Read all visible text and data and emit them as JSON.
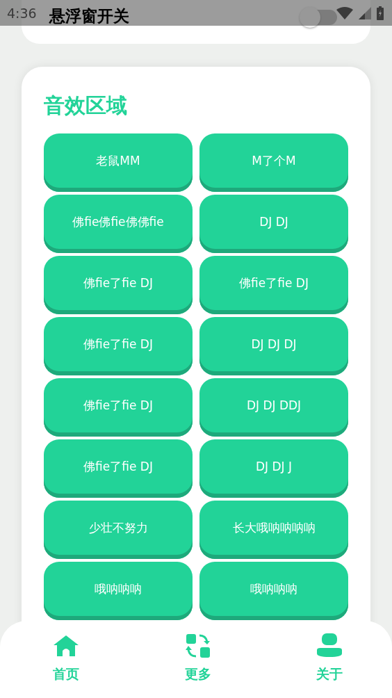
{
  "status_bar": {
    "time": "4:36"
  },
  "float_window": {
    "title": "悬浮窗开关",
    "on": false
  },
  "sound_section": {
    "title": "音效区域",
    "buttons": [
      {
        "label": "老鼠MM"
      },
      {
        "label": "M了个M"
      },
      {
        "label": "佛fie佛fie佛佛fie"
      },
      {
        "label": "DJ DJ"
      },
      {
        "label": "佛fie了fie DJ"
      },
      {
        "label": "佛fie了fie DJ"
      },
      {
        "label": "佛fie了fie DJ"
      },
      {
        "label": "DJ DJ DJ"
      },
      {
        "label": "佛fie了fie DJ"
      },
      {
        "label": "DJ DJ DDJ"
      },
      {
        "label": "佛fie了fie DJ"
      },
      {
        "label": "DJ DJ J"
      },
      {
        "label": "少壮不努力"
      },
      {
        "label": "长大哦呐呐呐呐"
      },
      {
        "label": "哦呐呐呐"
      },
      {
        "label": "哦呐呐呐"
      }
    ]
  },
  "bottom_nav": [
    {
      "label": "首页",
      "kind": "home"
    },
    {
      "label": "更多",
      "kind": "swap"
    },
    {
      "label": "关于",
      "kind": "user"
    }
  ]
}
